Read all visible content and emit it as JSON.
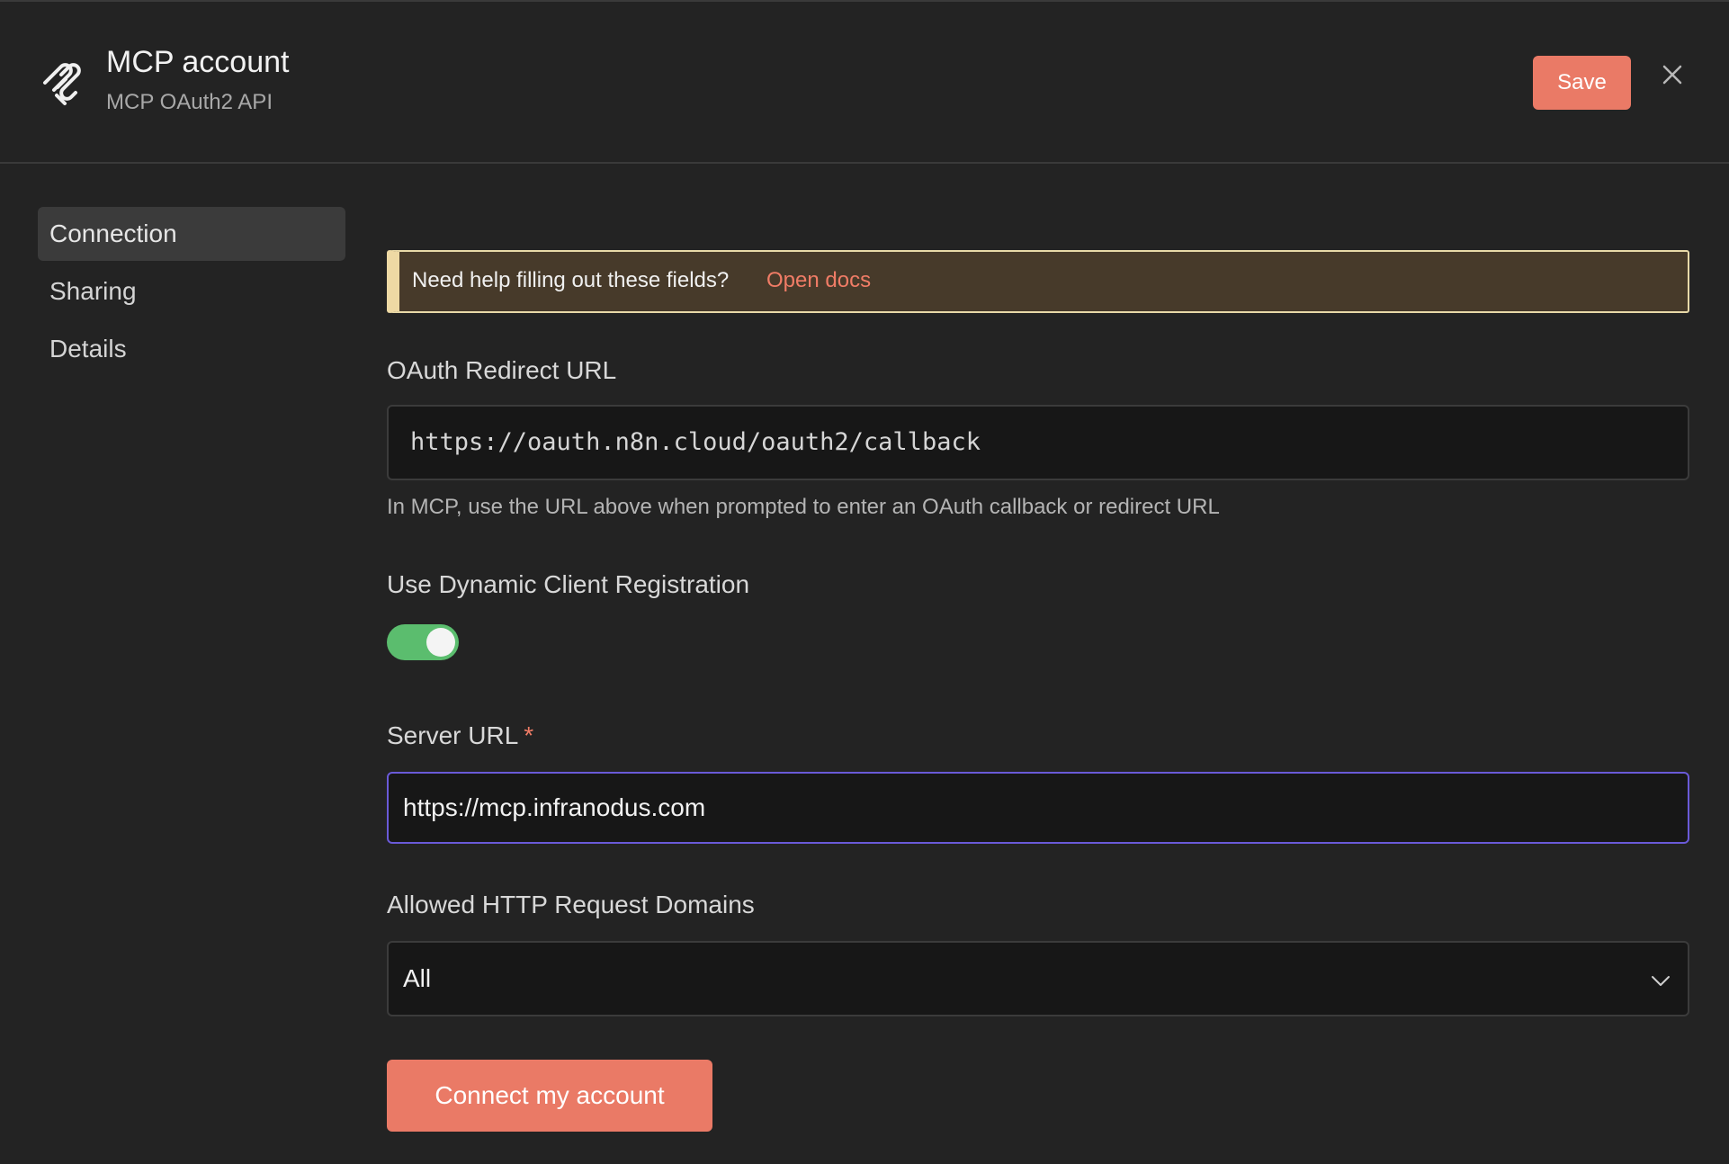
{
  "header": {
    "title": "MCP account",
    "subtitle": "MCP OAuth2 API",
    "save_label": "Save"
  },
  "sidebar": {
    "items": [
      {
        "label": "Connection",
        "active": true
      },
      {
        "label": "Sharing",
        "active": false
      },
      {
        "label": "Details",
        "active": false
      }
    ]
  },
  "help": {
    "text": "Need help filling out these fields?",
    "link": "Open docs"
  },
  "fields": {
    "redirect_label": "OAuth Redirect URL",
    "redirect_value": "https://oauth.n8n.cloud/oauth2/callback",
    "redirect_hint": "In MCP, use the URL above when prompted to enter an OAuth callback or redirect URL",
    "dcr_label": "Use Dynamic Client Registration",
    "dcr_enabled": true,
    "server_label": "Server URL",
    "server_required": "*",
    "server_value": "https://mcp.infranodus.com",
    "domains_label": "Allowed HTTP Request Domains",
    "domains_value": "All"
  },
  "actions": {
    "connect_label": "Connect my account"
  },
  "colors": {
    "accent": "#ea7a66",
    "toggle_on": "#5bbd6e",
    "focus_border": "#6a5ad8",
    "banner_bg": "#473a2a"
  }
}
